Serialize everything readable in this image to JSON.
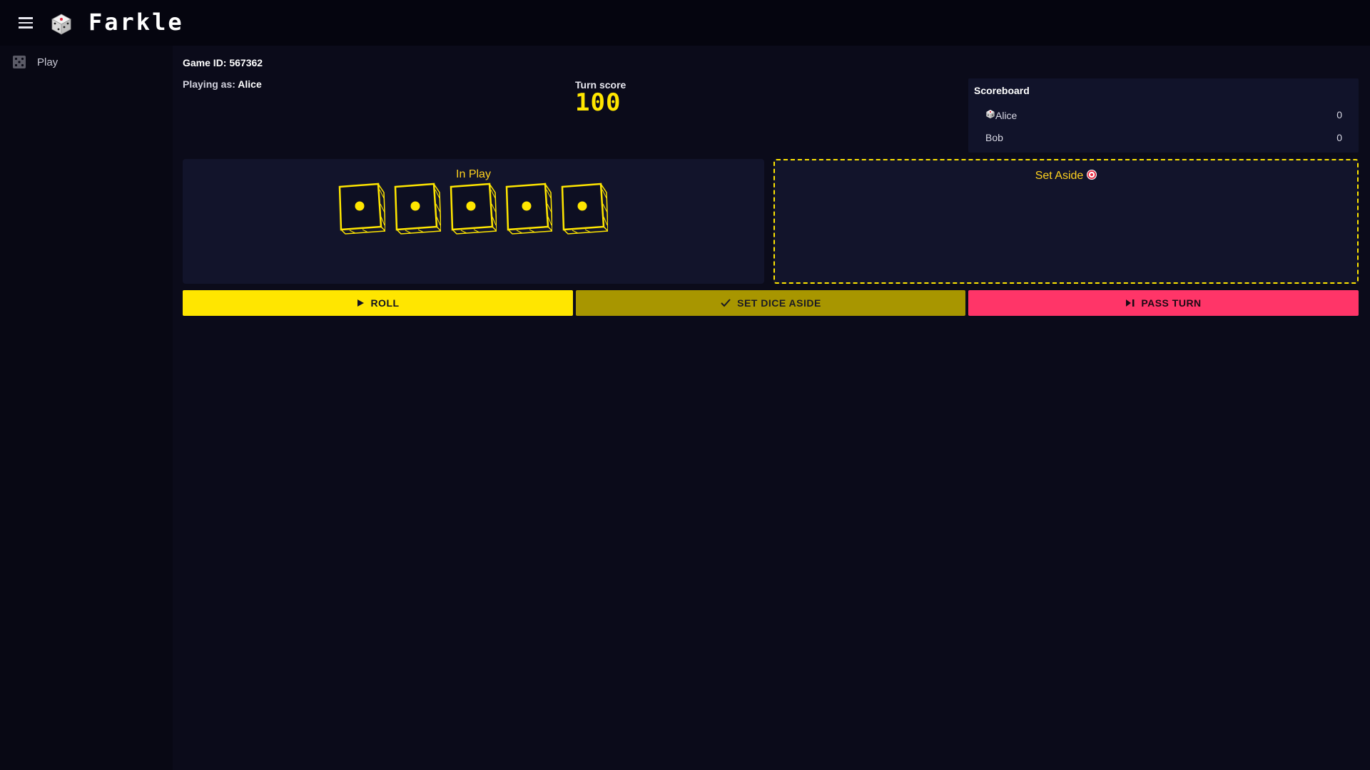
{
  "app": {
    "title": "Farkle"
  },
  "sidebar": {
    "items": [
      {
        "label": "Play",
        "icon": "dice-icon"
      }
    ]
  },
  "game": {
    "id_label": "Game ID: 567362",
    "playing_as_prefix": "Playing as: ",
    "playing_as_name": "Alice",
    "turn_score_label": "Turn score",
    "turn_score_value": "100"
  },
  "scoreboard": {
    "title": "Scoreboard",
    "players": [
      {
        "name": "Alice",
        "score": "0",
        "active": true,
        "icon": "die-icon"
      },
      {
        "name": "Bob",
        "score": "0",
        "active": false
      }
    ]
  },
  "in_play": {
    "title": "In Play",
    "dice": [
      {
        "value": 1
      },
      {
        "value": 1
      },
      {
        "value": 1
      },
      {
        "value": 1
      },
      {
        "value": 1
      }
    ]
  },
  "set_aside": {
    "title": "Set Aside",
    "icon": "target-icon",
    "dice": []
  },
  "actions": {
    "roll": "ROLL",
    "set_aside": "SET DICE ASIDE",
    "pass_turn": "PASS TURN"
  },
  "colors": {
    "accent_yellow": "#ffe600",
    "accent_yellow_dim": "#a89600",
    "accent_pink": "#ff3568",
    "background": "#0b0b1a",
    "panel": "#12142b"
  }
}
